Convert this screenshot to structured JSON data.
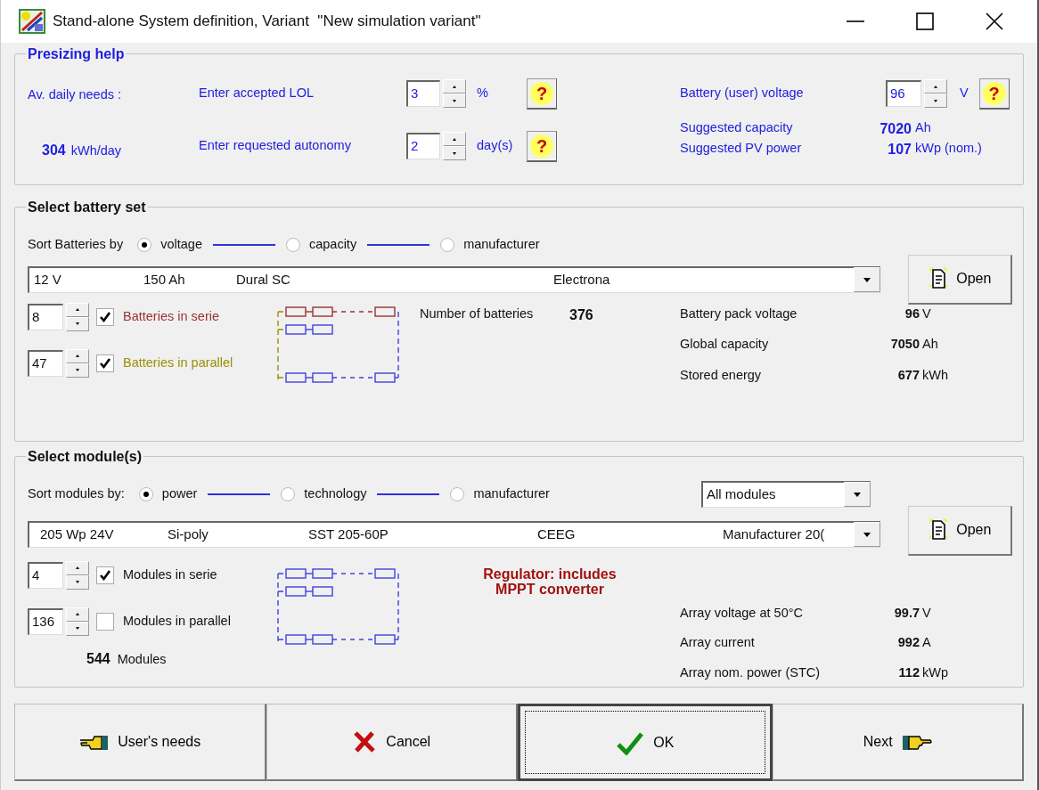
{
  "window": {
    "title": "Stand-alone System definition, Variant  \"New simulation variant\""
  },
  "presizing": {
    "title": "Presizing help",
    "daily_needs": {
      "label": "Av. daily needs :",
      "value": "304",
      "unit": "kWh/day"
    },
    "inputs": [
      {
        "label": "Enter accepted LOL",
        "value": "3",
        "unit": "%",
        "help": "?"
      },
      {
        "label": "Enter requested autonomy",
        "value": "2",
        "unit": "day(s)",
        "help": "?"
      }
    ],
    "battery_voltage": {
      "label": "Battery (user) voltage",
      "value": "96",
      "unit": "V",
      "help": "?"
    },
    "suggested": [
      {
        "label": "Suggested capacity",
        "value": "7020",
        "unit": "Ah"
      },
      {
        "label": "Suggested PV power",
        "value": "107",
        "unit": "kWp (nom.)"
      }
    ]
  },
  "battery_set": {
    "title": "Select battery set",
    "sort_label": "Sort Batteries by",
    "sort_options": [
      {
        "label": "voltage",
        "selected": true
      },
      {
        "label": "capacity",
        "selected": false
      },
      {
        "label": "manufacturer",
        "selected": false
      }
    ],
    "selection": [
      "12 V",
      "150 Ah",
      "Dural SC",
      "Electrona"
    ],
    "open_button": "Open",
    "counts": [
      {
        "value": "8",
        "checked": true,
        "label": "Batteries in serie",
        "color": "#993333"
      },
      {
        "value": "47",
        "checked": true,
        "label": "Batteries in parallel",
        "color": "#9c8f00"
      }
    ],
    "number": {
      "label": "Number of batteries",
      "value": "376"
    },
    "results": [
      {
        "label": "Battery pack voltage",
        "value": "96",
        "unit": "V"
      },
      {
        "label": "Global capacity",
        "value": "7050",
        "unit": "Ah"
      },
      {
        "label": "Stored energy",
        "value": "677",
        "unit": "kWh"
      }
    ]
  },
  "modules": {
    "title": "Select module(s)",
    "sort_label": "Sort modules by:",
    "sort_options": [
      {
        "label": "power",
        "selected": true
      },
      {
        "label": "technology",
        "selected": false
      },
      {
        "label": "manufacturer",
        "selected": false
      }
    ],
    "filter": "All modules",
    "selection": [
      "205 Wp 24V",
      "Si-poly",
      "SST 205-60P",
      "CEEG",
      "Manufacturer 20("
    ],
    "open_button": "Open",
    "counts": [
      {
        "value": "4",
        "checked": true,
        "label": "Modules in serie"
      },
      {
        "value": "136",
        "checked": false,
        "label": "Modules in parallel"
      }
    ],
    "total": {
      "value": "544",
      "label": "Modules"
    },
    "regulator_note": [
      "Regulator: includes",
      "MPPT converter"
    ],
    "results": [
      {
        "label": "Array voltage at 50°C",
        "value": "99.7",
        "unit": "V"
      },
      {
        "label": "Array current",
        "value": "992",
        "unit": "A"
      },
      {
        "label": "Array nom. power (STC)",
        "value": "112",
        "unit": "kWp"
      }
    ]
  },
  "buttons": [
    {
      "label": "User's needs",
      "kind": "back",
      "focused": false
    },
    {
      "label": "Cancel",
      "kind": "cancel",
      "focused": false
    },
    {
      "label": "OK",
      "kind": "ok",
      "focused": true
    },
    {
      "label": "Next",
      "kind": "next",
      "focused": false
    }
  ]
}
